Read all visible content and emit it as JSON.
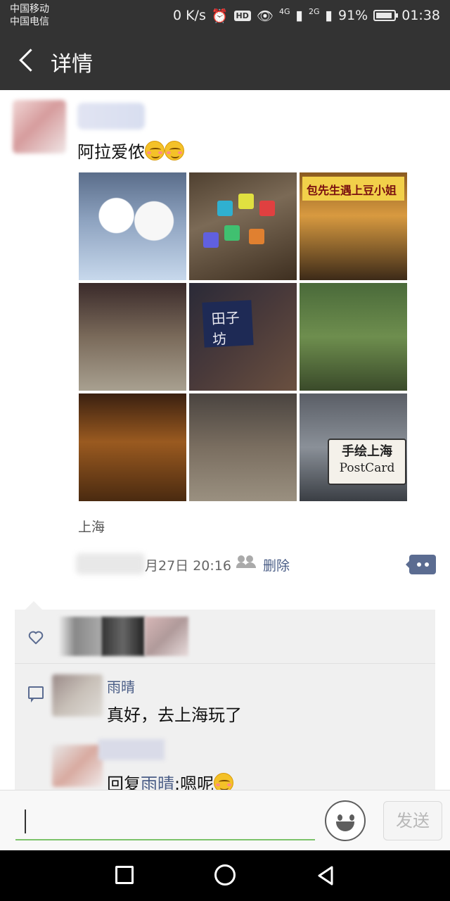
{
  "status_bar": {
    "carrier_1": "中国移动",
    "carrier_2": "中国电信",
    "net_speed": "0 K/s",
    "hd": "HD",
    "signal_1": "4G",
    "signal_2": "2G",
    "battery": "91%",
    "battery_level": 0.91,
    "time": "01:38"
  },
  "header": {
    "title": "详情"
  },
  "post": {
    "text": "阿拉爱侬",
    "photos": [
      {
        "icon": "dolls-photo"
      },
      {
        "icon": "mailboxes-photo"
      },
      {
        "icon": "shopfront-photo",
        "sign": "包先生遇上豆小姐"
      },
      {
        "icon": "alley-photo"
      },
      {
        "icon": "tianzifang-sign-photo",
        "sign": "田子坊"
      },
      {
        "icon": "green-plants-photo"
      },
      {
        "icon": "cafe-interior-photo"
      },
      {
        "icon": "lane-photo"
      },
      {
        "icon": "postcard-sign-photo",
        "sign_line1": "手绘上海",
        "sign_line2": "PostCard"
      }
    ],
    "location": "上海",
    "time_partial": "月27日 20:16",
    "delete_label": "删除"
  },
  "comments": {
    "items": [
      {
        "name": "雨晴",
        "text": "真好，去上海玩了"
      },
      {
        "reply_prefix": "回复",
        "reply_to": "雨晴",
        "text": ":嗯呢"
      }
    ]
  },
  "input_bar": {
    "send_label": "发送"
  },
  "colors": {
    "title_bar": "#333333",
    "link": "#4a5d86",
    "more_button": "#5b6c91",
    "input_underline": "#7cc36a"
  }
}
